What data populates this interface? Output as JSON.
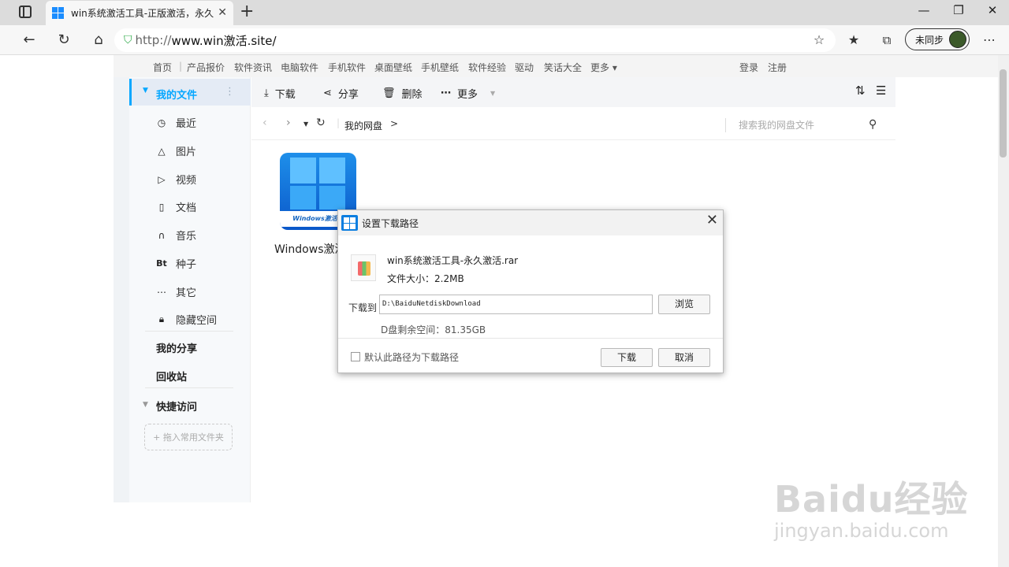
{
  "browser": {
    "tab_title": "win系统激活工具-正版激活，永久",
    "tab_close": "✕",
    "new_tab": "+",
    "url_protocol": "http://",
    "url_host": "www.win激活.site/",
    "sync_label": "未同步",
    "window_buttons": [
      "—",
      "❐",
      "✕"
    ]
  },
  "site_nav": {
    "left_items": [
      "首页",
      "产品报价",
      "软件资讯",
      "电脑软件",
      "手机软件",
      "桌面壁纸",
      "手机壁纸",
      "软件经验",
      "驱动",
      "笑话大全",
      "更多 ▾"
    ],
    "right_items": [
      "登录",
      "注册"
    ]
  },
  "sidebar": {
    "my_files": "我的文件",
    "items": [
      {
        "label": "最近",
        "icon": "clock-icon"
      },
      {
        "label": "图片",
        "icon": "image-icon"
      },
      {
        "label": "视频",
        "icon": "play-icon"
      },
      {
        "label": "文档",
        "icon": "document-icon"
      },
      {
        "label": "音乐",
        "icon": "headphone-icon"
      },
      {
        "label": "种子",
        "icon": "bt-icon"
      },
      {
        "label": "其它",
        "icon": "more-icon"
      },
      {
        "label": "隐藏空间",
        "icon": "lock-icon"
      }
    ],
    "my_share": "我的分享",
    "recycle": "回收站",
    "quick_access": "快捷访问",
    "add_folder": "+ 拖入常用文件夹"
  },
  "toolbar": {
    "download": "下载",
    "share": "分享",
    "delete": "删除",
    "more": "更多"
  },
  "path": {
    "crumb": "我的网盘",
    "search_placeholder": "搜索我的网盘文件"
  },
  "file": {
    "icon_text": "Windows激活工",
    "name": "Windows激活"
  },
  "dialog": {
    "title": "设置下载路径",
    "file_name": "win系统激活工具-永久激活.rar",
    "file_size": "文件大小：2.2MB",
    "download_to_label": "下载到",
    "path_value": "D:\\BaiduNetdiskDownload",
    "browse": "浏览",
    "free_space": "D盘剩余空间：81.35GB",
    "default_checkbox": "默认此路径为下载路径",
    "download_btn": "下载",
    "cancel_btn": "取消"
  },
  "watermark": {
    "logo": "Baidu经验",
    "url": "jingyan.baidu.com"
  }
}
